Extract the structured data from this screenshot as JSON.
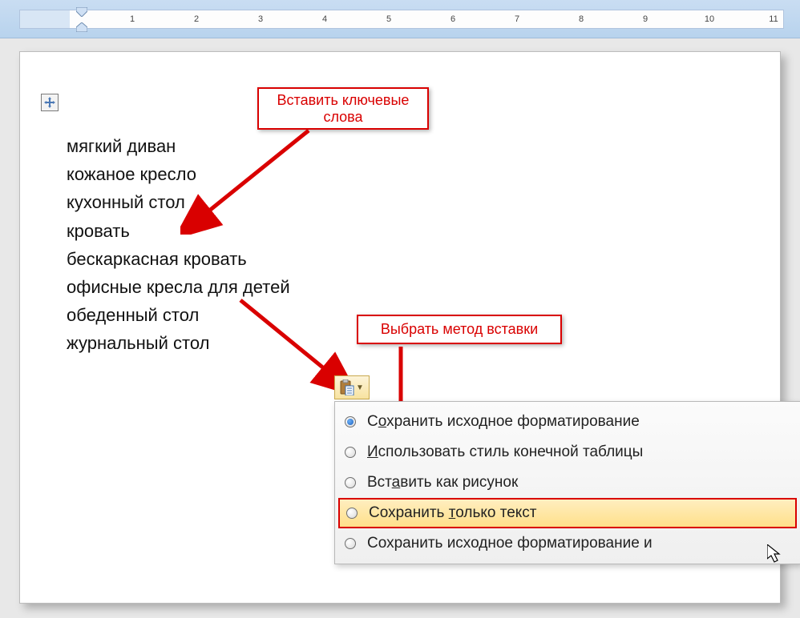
{
  "ruler": {
    "marks": [
      "1",
      "2",
      "3",
      "4",
      "5",
      "6",
      "7",
      "8",
      "9",
      "10",
      "11"
    ]
  },
  "callouts": {
    "insert_keywords_l1": "Вставить ключевые",
    "insert_keywords_l2": "слова",
    "choose_method": "Выбрать метод вставки"
  },
  "keywords": [
    "мягкий диван",
    "кожаное кресло",
    "кухонный стол",
    "кровать",
    "бескаркасная кровать",
    "офисные кресла для детей",
    "обеденный стол",
    "журнальный стол"
  ],
  "paste_menu": {
    "item1_pre": "С",
    "item1_u": "о",
    "item1_post": "хранить исходное форматирование",
    "item2_u": "И",
    "item2_post": "спользовать стиль конечной таблицы",
    "item3_pre": "Вст",
    "item3_u": "а",
    "item3_post": "вить как рисунок",
    "item4_pre": "Сохранить ",
    "item4_u": "т",
    "item4_post": "олько текст",
    "item5_pre": "Сохранить исходное форматирование и "
  }
}
